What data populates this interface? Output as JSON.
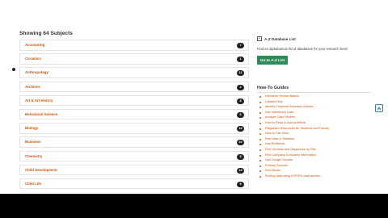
{
  "subjects": {
    "heading": "Showing 64 Subjects",
    "items": [
      {
        "label": "Accounting",
        "count": "7"
      },
      {
        "label": "Ceramics",
        "count": "1"
      },
      {
        "label": "Anthropology",
        "count": "12"
      },
      {
        "label": "Archives",
        "count": "2"
      },
      {
        "label": "Art & Art History",
        "count": "8"
      },
      {
        "label": "Behavioral Science",
        "count": "6"
      },
      {
        "label": "Biology",
        "count": "18"
      },
      {
        "label": "Business",
        "count": "40"
      },
      {
        "label": "Chemistry",
        "count": "9"
      },
      {
        "label": "Child Development",
        "count": "18"
      },
      {
        "label": "Child Life",
        "count": "5"
      }
    ]
  },
  "az": {
    "title": "A-Z Database List",
    "description": "Find an alphabetical list of databases for your research here!",
    "button_label": "Go to A-Z List"
  },
  "howto": {
    "title": "How-To Guides",
    "items": [
      "Literature Review Basics",
      "Citation Help",
      "Identify Empirical Research Articles",
      "Use Interlibrary Loan",
      "Analyze Case Studies",
      "How to Read a Journal Article",
      "Plagiarism Resources for Students and Faculty",
      "How to Cite Data",
      "Find Data & Statistics",
      "Use RefWorks",
      "Find Journals and Magazines by Title",
      "Find Company & Industry Information",
      "Use Google Scholar",
      "Primary Sources",
      "Find Books",
      "Finding data using ICPSR's data archive"
    ]
  },
  "colors": {
    "link": "#c9560b",
    "button": "#2f8a5a",
    "badge": "#222222",
    "back_to_top": "#2c7ea6"
  },
  "icons": {
    "back_to_top": "chevron-up-icon",
    "az_toggle": "plus-icon"
  }
}
